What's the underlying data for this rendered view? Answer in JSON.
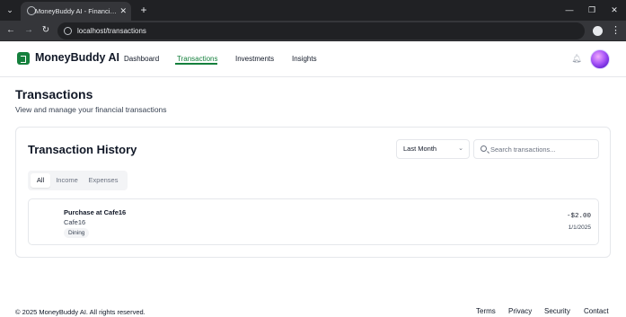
{
  "browser": {
    "tab_title": "MoneyBuddy AI - Financial Ma",
    "url": "localhost/transactions"
  },
  "header": {
    "brand": "MoneyBuddy AI",
    "brand_color": "#15803d",
    "nav": [
      {
        "label": "Dashboard",
        "active": false
      },
      {
        "label": "Transactions",
        "active": true
      },
      {
        "label": "Investments",
        "active": false
      },
      {
        "label": "Insights",
        "active": false
      }
    ],
    "icons": [
      "bell-icon",
      "avatar"
    ]
  },
  "page": {
    "title": "Transactions",
    "subtitle": "View and manage your financial transactions"
  },
  "card": {
    "title": "Transaction History",
    "period_select": "Last Month",
    "search_placeholder": "Search transactions...",
    "tabs": [
      {
        "label": "All",
        "active": true
      },
      {
        "label": "Income",
        "active": false
      },
      {
        "label": "Expenses",
        "active": false
      }
    ],
    "transactions": [
      {
        "description": "Purchase at Cafe16",
        "merchant": "Cafe16",
        "category": "Dining",
        "amount": "-$2.00",
        "date": "1/1/2025"
      }
    ]
  },
  "footer": {
    "copyright": "© 2025 MoneyBuddy AI. All rights reserved.",
    "links": [
      "Terms",
      "Privacy",
      "Security",
      "Contact"
    ]
  }
}
